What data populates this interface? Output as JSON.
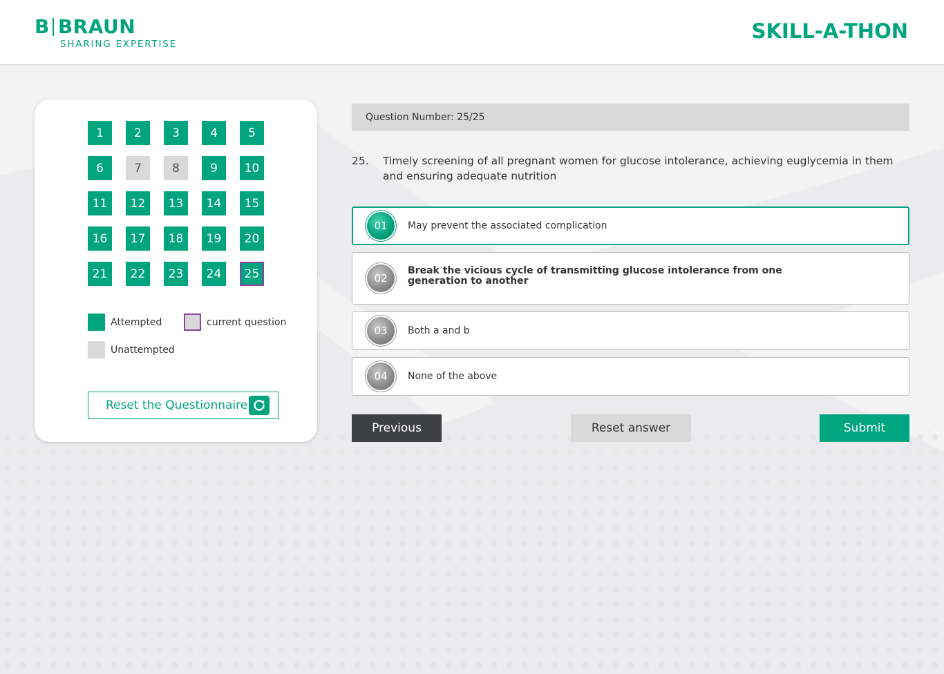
{
  "header": {
    "logo_b": "B",
    "logo_brand": "BRAUN",
    "logo_tagline": "SHARING EXPERTISE",
    "app_title": "SKILL-A-THON"
  },
  "navigator": {
    "questions": [
      {
        "label": "1",
        "status": "attempted"
      },
      {
        "label": "2",
        "status": "attempted"
      },
      {
        "label": "3",
        "status": "attempted"
      },
      {
        "label": "4",
        "status": "attempted"
      },
      {
        "label": "5",
        "status": "attempted"
      },
      {
        "label": "6",
        "status": "attempted"
      },
      {
        "label": "7",
        "status": "unattempted"
      },
      {
        "label": "8",
        "status": "unattempted"
      },
      {
        "label": "9",
        "status": "attempted"
      },
      {
        "label": "10",
        "status": "attempted"
      },
      {
        "label": "11",
        "status": "attempted"
      },
      {
        "label": "12",
        "status": "attempted"
      },
      {
        "label": "13",
        "status": "attempted"
      },
      {
        "label": "14",
        "status": "attempted"
      },
      {
        "label": "15",
        "status": "attempted"
      },
      {
        "label": "16",
        "status": "attempted"
      },
      {
        "label": "17",
        "status": "attempted"
      },
      {
        "label": "18",
        "status": "attempted"
      },
      {
        "label": "19",
        "status": "attempted"
      },
      {
        "label": "20",
        "status": "attempted"
      },
      {
        "label": "21",
        "status": "attempted"
      },
      {
        "label": "22",
        "status": "attempted"
      },
      {
        "label": "23",
        "status": "attempted"
      },
      {
        "label": "24",
        "status": "attempted"
      },
      {
        "label": "25",
        "status": "attempted",
        "current": true
      }
    ],
    "legend": {
      "attempted": "Attempted",
      "current": "current question",
      "unattempted": "Unattempted"
    },
    "reset_questionnaire_label": "Reset the Questionnaire",
    "reset_icon": "refresh-icon"
  },
  "question": {
    "number_label": "Question Number: 25/25",
    "index": "25.",
    "text": "Timely screening of all pregnant women for glucose intolerance, achieving euglycemia in them and ensuring adequate nutrition",
    "options": [
      {
        "badge": "01",
        "text": "May prevent the associated complication",
        "selected": true
      },
      {
        "badge": "02",
        "text": "Break the vicious cycle of transmitting glucose intolerance from one generation to another",
        "selected": false
      },
      {
        "badge": "03",
        "text": "Both a and b",
        "selected": false
      },
      {
        "badge": "04",
        "text": "None of the above",
        "selected": false
      }
    ]
  },
  "actions": {
    "previous": "Previous",
    "reset_answer": "Reset answer",
    "submit": "Submit"
  },
  "colors": {
    "brand_green": "#00a47e",
    "current_outline": "#8e3fa0",
    "unattempted_gray": "#d9d9d9",
    "dark_button": "#3f4044"
  }
}
